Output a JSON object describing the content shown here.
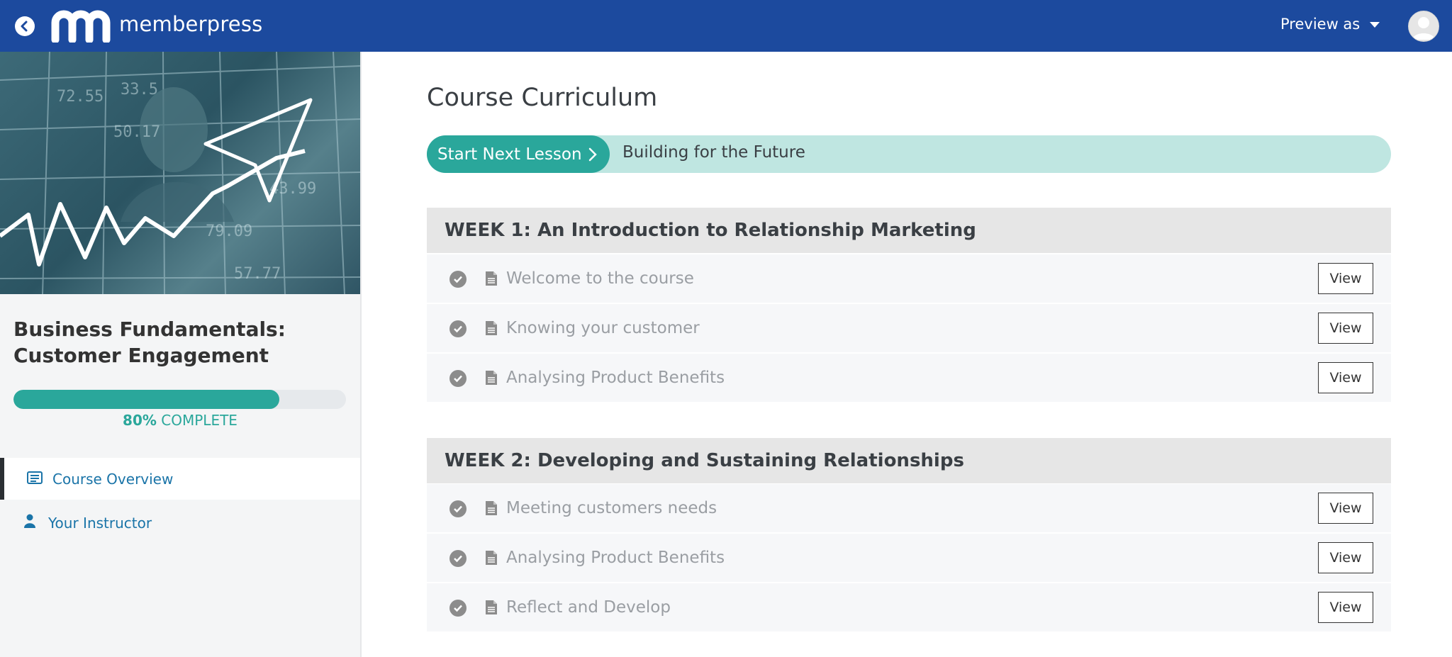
{
  "header": {
    "logo_text": "memberpress",
    "preview_label": "Preview as",
    "colors": {
      "bar": "#1c4a9e"
    }
  },
  "sidebar": {
    "course_title": "Business Fundamentals: Customer Engagement",
    "progress": {
      "percent_value": 80,
      "percent_label": "80%",
      "complete_label": "COMPLETE"
    },
    "nav": [
      {
        "label": "Course Overview",
        "icon": "list-icon",
        "active": true
      },
      {
        "label": "Your Instructor",
        "icon": "user-icon",
        "active": false
      }
    ]
  },
  "main": {
    "title": "Course Curriculum",
    "next": {
      "button_label": "Start Next Lesson",
      "lesson_title": "Building for the Future"
    },
    "sections": [
      {
        "heading": "WEEK 1: An Introduction to Relationship Marketing",
        "lessons": [
          {
            "title": "Welcome to the course",
            "action": "View"
          },
          {
            "title": "Knowing your customer",
            "action": "View"
          },
          {
            "title": "Analysing Product Benefits",
            "action": "View"
          }
        ]
      },
      {
        "heading": "WEEK 2: Developing and Sustaining Relationships",
        "lessons": [
          {
            "title": "Meeting customers needs",
            "action": "View"
          },
          {
            "title": "Analysing Product Benefits",
            "action": "View"
          },
          {
            "title": "Reflect and Develop",
            "action": "View"
          }
        ]
      }
    ]
  },
  "colors": {
    "accent": "#2aa79b",
    "accent_light": "#bfe6e1",
    "link": "#1a74a8"
  }
}
